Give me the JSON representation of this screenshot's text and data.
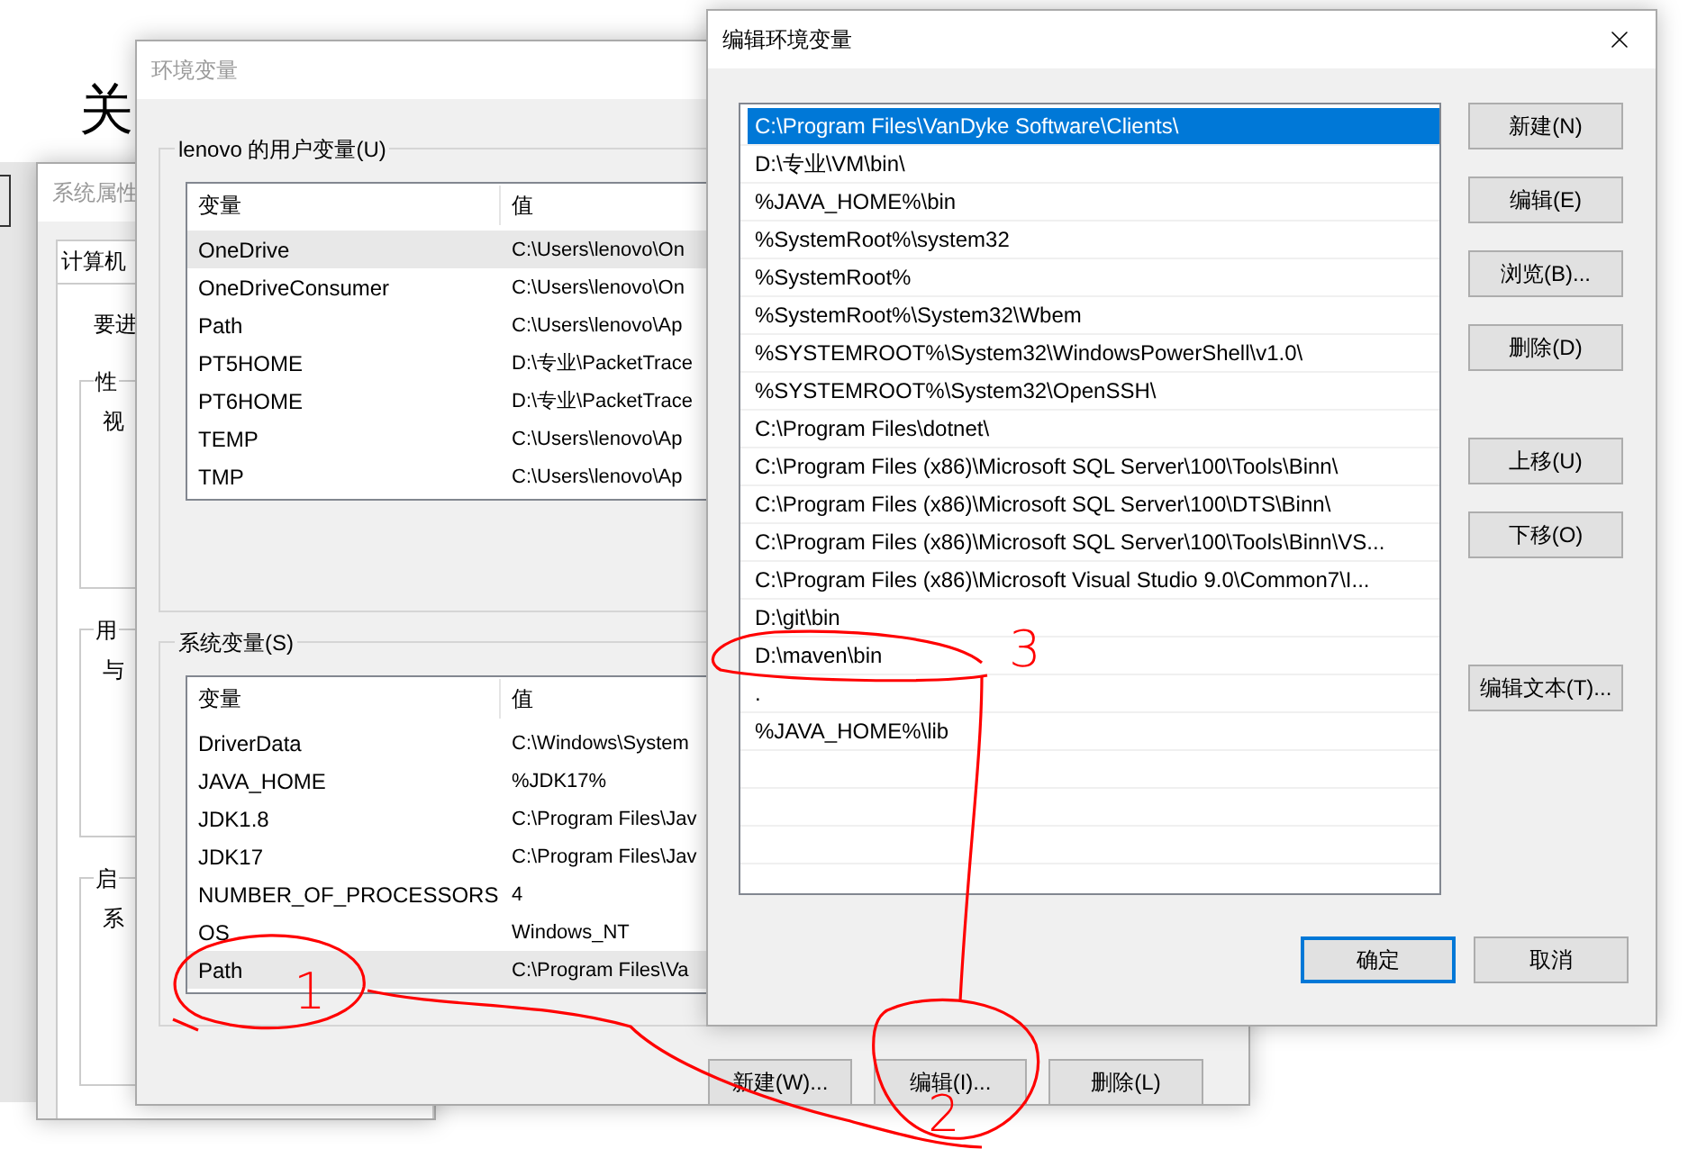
{
  "background_page": {
    "heading": "关"
  },
  "system_properties": {
    "title": "系统属性",
    "tab": "计算机",
    "intro": "要进",
    "groups": [
      {
        "label": "性",
        "text": "视"
      },
      {
        "label": "用",
        "text": "与"
      },
      {
        "label": "启",
        "text": "系"
      }
    ]
  },
  "env_window": {
    "title": "环境变量",
    "user_group": {
      "label": "lenovo 的用户变量(U)",
      "columns": [
        "变量",
        "值"
      ],
      "rows": [
        {
          "name": "OneDrive",
          "value": "C:\\Users\\lenovo\\On",
          "selected": true
        },
        {
          "name": "OneDriveConsumer",
          "value": "C:\\Users\\lenovo\\On",
          "selected": false
        },
        {
          "name": "Path",
          "value": "C:\\Users\\lenovo\\Ap",
          "selected": false
        },
        {
          "name": "PT5HOME",
          "value": "D:\\专业\\PacketTrace",
          "selected": false
        },
        {
          "name": "PT6HOME",
          "value": "D:\\专业\\PacketTrace",
          "selected": false
        },
        {
          "name": "TEMP",
          "value": "C:\\Users\\lenovo\\Ap",
          "selected": false
        },
        {
          "name": "TMP",
          "value": "C:\\Users\\lenovo\\Ap",
          "selected": false
        }
      ]
    },
    "system_group": {
      "label": "系统变量(S)",
      "columns": [
        "变量",
        "值"
      ],
      "rows": [
        {
          "name": "DriverData",
          "value": "C:\\Windows\\System",
          "selected": false
        },
        {
          "name": "JAVA_HOME",
          "value": "%JDK17%",
          "selected": false
        },
        {
          "name": "JDK1.8",
          "value": "C:\\Program Files\\Jav",
          "selected": false
        },
        {
          "name": "JDK17",
          "value": "C:\\Program Files\\Jav",
          "selected": false
        },
        {
          "name": "NUMBER_OF_PROCESSORS",
          "value": "4",
          "selected": false
        },
        {
          "name": "OS",
          "value": "Windows_NT",
          "selected": false
        },
        {
          "name": "Path",
          "value": "C:\\Program Files\\Va",
          "selected": true
        }
      ]
    },
    "buttons": [
      "新建(W)...",
      "编辑(I)...",
      "删除(L)"
    ]
  },
  "edit_window": {
    "title": "编辑环境变量",
    "entries": [
      {
        "text": "C:\\Program Files\\VanDyke Software\\Clients\\",
        "selected": true
      },
      {
        "text": "D:\\专业\\VM\\bin\\",
        "selected": false
      },
      {
        "text": "%JAVA_HOME%\\bin",
        "selected": false
      },
      {
        "text": "%SystemRoot%\\system32",
        "selected": false
      },
      {
        "text": "%SystemRoot%",
        "selected": false
      },
      {
        "text": "%SystemRoot%\\System32\\Wbem",
        "selected": false
      },
      {
        "text": "%SYSTEMROOT%\\System32\\WindowsPowerShell\\v1.0\\",
        "selected": false
      },
      {
        "text": "%SYSTEMROOT%\\System32\\OpenSSH\\",
        "selected": false
      },
      {
        "text": "C:\\Program Files\\dotnet\\",
        "selected": false
      },
      {
        "text": "C:\\Program Files (x86)\\Microsoft SQL Server\\100\\Tools\\Binn\\",
        "selected": false
      },
      {
        "text": "C:\\Program Files (x86)\\Microsoft SQL Server\\100\\DTS\\Binn\\",
        "selected": false
      },
      {
        "text": "C:\\Program Files (x86)\\Microsoft SQL Server\\100\\Tools\\Binn\\VS...",
        "selected": false
      },
      {
        "text": "C:\\Program Files (x86)\\Microsoft Visual Studio 9.0\\Common7\\I...",
        "selected": false
      },
      {
        "text": "D:\\git\\bin",
        "selected": false
      },
      {
        "text": "D:\\maven\\bin",
        "selected": false
      },
      {
        "text": ".",
        "selected": false
      },
      {
        "text": "%JAVA_HOME%\\lib",
        "selected": false
      }
    ],
    "side_buttons": [
      {
        "label": "新建(N)",
        "kind": "top"
      },
      {
        "label": "编辑(E)",
        "kind": "top"
      },
      {
        "label": "浏览(B)...",
        "kind": "top"
      },
      {
        "label": "删除(D)",
        "kind": "top"
      },
      {
        "label": "上移(U)",
        "kind": "move"
      },
      {
        "label": "下移(O)",
        "kind": "move"
      },
      {
        "label": "编辑文本(T)...",
        "kind": "text"
      }
    ],
    "footer_buttons": [
      {
        "label": "确定",
        "default": true
      },
      {
        "label": "取消",
        "default": false
      }
    ]
  },
  "annotations": [
    {
      "label": "1"
    },
    {
      "label": "2"
    },
    {
      "label": "3"
    }
  ]
}
